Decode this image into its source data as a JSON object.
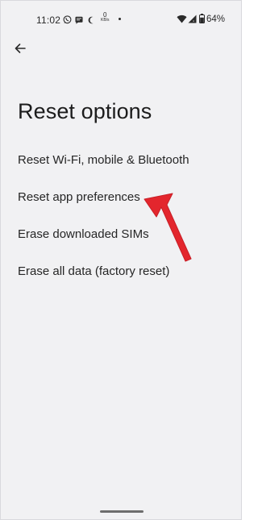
{
  "status_bar": {
    "time": "11:02",
    "net_speed_value": "0",
    "net_speed_unit": "KB/s",
    "battery_percent": "64%",
    "icons": [
      "whatsapp-icon",
      "message-icon",
      "moon-icon",
      "network-speed",
      "dot",
      "wifi-icon",
      "signal-icon",
      "battery-icon"
    ]
  },
  "header": {
    "back_icon": "arrow-left-icon",
    "title": "Reset options"
  },
  "options": [
    {
      "label": "Reset Wi-Fi, mobile & Bluetooth"
    },
    {
      "label": "Reset app preferences"
    },
    {
      "label": "Erase downloaded SIMs"
    },
    {
      "label": "Erase all data (factory reset)"
    }
  ],
  "annotation": {
    "arrow_color": "#e3262d",
    "points_to": "Reset app preferences"
  },
  "colors": {
    "background": "#f1f1f3",
    "text": "#1f1f1f",
    "arrow": "#e3262d"
  }
}
